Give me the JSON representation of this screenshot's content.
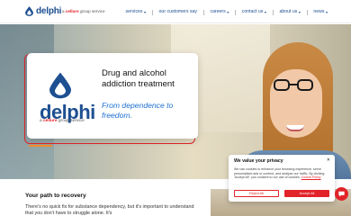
{
  "header": {
    "logo_text": "delphi",
    "tagline_prefix": "a",
    "tagline_brand": "cellure",
    "tagline_suffix": "group service",
    "nav": [
      {
        "label": "services"
      },
      {
        "label": "our customers say"
      },
      {
        "label": "careers"
      },
      {
        "label": "contact us"
      },
      {
        "label": "about us"
      },
      {
        "label": "news"
      }
    ]
  },
  "hero": {
    "logo_text": "delphi",
    "tagline_prefix": "a",
    "tagline_brand": "cellure",
    "tagline_suffix": "group service",
    "title": "Drug and alcohol addiction treatment",
    "subtitle": "From dependence to freedom."
  },
  "section": {
    "title": "Your path to recovery",
    "text": "There's no quick fix for substance dependency, but it's important to understand that you don't have to struggle alone. It's"
  },
  "cookie": {
    "title": "We value your privacy",
    "body": "We use cookies to enhance your browsing experience, serve personalised ads or content, and analyse our traffic. By clicking 'Accept All', you consent to our use of cookies.",
    "policy_link": "Cookie Policy",
    "reject_label": "Reject All",
    "accept_label": "Accept All"
  },
  "colors": {
    "brand_blue": "#1d4f91",
    "brand_red": "#e2232a",
    "accent_orange": "#f28c28",
    "subtitle_blue": "#1d6fd1"
  }
}
